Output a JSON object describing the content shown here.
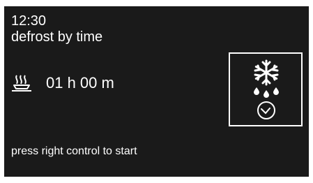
{
  "display": {
    "time": "12:30",
    "mode_label": "defrost by time",
    "duration": "01 h 00 m",
    "hint": "press right control to start",
    "icons": {
      "dish": "defrost-dish-icon",
      "mode": "snowflake-icon",
      "drops": "water-drops-icon",
      "timer": "clock-icon"
    },
    "colors": {
      "background": "#1a1a1a",
      "foreground": "#ffffff"
    }
  }
}
